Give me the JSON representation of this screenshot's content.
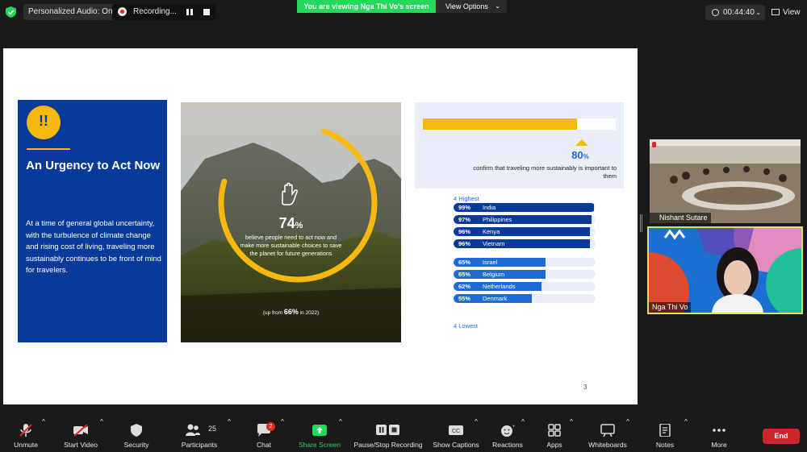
{
  "topbar": {
    "audio_label": "Personalized Audio: On",
    "recording_label": "Recording...",
    "viewing_label": "You are viewing Nga Thi Vo's screen",
    "view_options_label": "View Options",
    "timer": "00:44:40",
    "view_label": "View"
  },
  "slide": {
    "urgency_title": "An Urgency to Act Now",
    "urgency_body": "At a time of general global uncertainty, with the turbulence of climate change and rising cost of living, traveling more sustainably continues to be front of mind for travelers.",
    "stat_main_value": "74",
    "stat_main_unit": "%",
    "stat_main_text": "believe people need to act now and make more sustainable choices to save the planet for future generations",
    "stat_main_progress": 0.74,
    "up_from_pre": "(up from",
    "up_from_value": "66%",
    "up_from_post": "in 2022)",
    "confirm_value": "80",
    "confirm_unit": "%",
    "confirm_progress": 0.8,
    "confirm_text": "confirm that traveling more sustainably is important to them",
    "highest_label": "4 Highest",
    "lowest_label": "4 Lowest",
    "highest": [
      {
        "pct": "99%",
        "country": "India",
        "value": 99
      },
      {
        "pct": "97%",
        "country": "Philippines",
        "value": 97
      },
      {
        "pct": "96%",
        "country": "Kenya",
        "value": 96
      },
      {
        "pct": "96%",
        "country": "Vietnam",
        "value": 96
      }
    ],
    "lowest": [
      {
        "pct": "65%",
        "country": "Israel",
        "value": 65
      },
      {
        "pct": "65%",
        "country": "Belgium",
        "value": 65
      },
      {
        "pct": "62%",
        "country": "Netherlands",
        "value": 62
      },
      {
        "pct": "55%",
        "country": "Denmark",
        "value": 55
      }
    ],
    "page_number": "3",
    "colors": {
      "blue": "#0a3a99",
      "yellow": "#f7b80f",
      "light_blue": "#1e6bd6"
    }
  },
  "participants": [
    {
      "name": "Nishant Sutare",
      "muted": true
    },
    {
      "name": "Nga Thi Vo",
      "muted": false
    }
  ],
  "toolbar": {
    "unmute": "Unmute",
    "start_video": "Start Video",
    "security": "Security",
    "participants": "Participants",
    "participants_count": "25",
    "chat": "Chat",
    "chat_badge": "2",
    "share_screen": "Share Screen",
    "pause_stop_recording": "Pause/Stop Recording",
    "show_captions": "Show Captions",
    "reactions": "Reactions",
    "apps": "Apps",
    "whiteboards": "Whiteboards",
    "notes": "Notes",
    "more": "More",
    "end": "End"
  }
}
